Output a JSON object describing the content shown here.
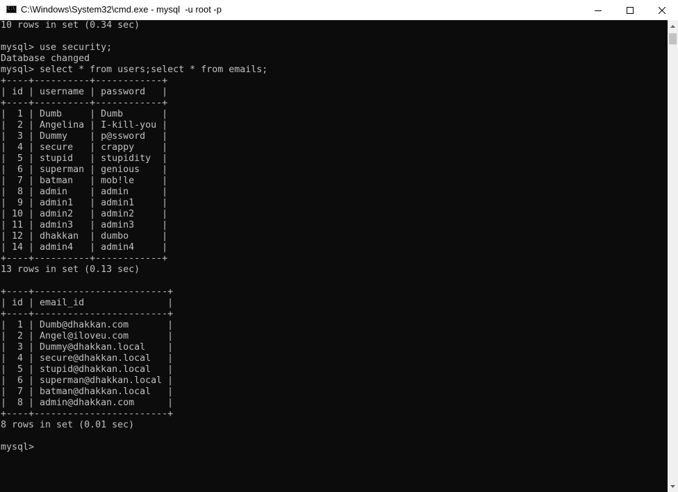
{
  "window": {
    "title": "C:\\Windows\\System32\\cmd.exe - mysql  -u root -p",
    "icon": "cmd-icon",
    "icon_text": "C:\\"
  },
  "console": {
    "lines": [
      "10 rows in set (0.34 sec)",
      "",
      "mysql> use security;",
      "Database changed",
      "mysql> select * from users;select * from emails;",
      "+----+----------+------------+",
      "| id | username | password   |",
      "+----+----------+------------+",
      "|  1 | Dumb     | Dumb       |",
      "|  2 | Angelina | I-kill-you |",
      "|  3 | Dummy    | p@ssword   |",
      "|  4 | secure   | crappy     |",
      "|  5 | stupid   | stupidity  |",
      "|  6 | superman | genious    |",
      "|  7 | batman   | mob!le     |",
      "|  8 | admin    | admin      |",
      "|  9 | admin1   | admin1     |",
      "| 10 | admin2   | admin2     |",
      "| 11 | admin3   | admin3     |",
      "| 12 | dhakkan  | dumbo      |",
      "| 14 | admin4   | admin4     |",
      "+----+----------+------------+",
      "13 rows in set (0.13 sec)",
      "",
      "+----+------------------------+",
      "| id | email_id               |",
      "+----+------------------------+",
      "|  1 | Dumb@dhakkan.com       |",
      "|  2 | Angel@iloveu.com       |",
      "|  3 | Dummy@dhakkan.local    |",
      "|  4 | secure@dhakkan.local   |",
      "|  5 | stupid@dhakkan.local   |",
      "|  6 | superman@dhakkan.local |",
      "|  7 | batman@dhakkan.local   |",
      "|  8 | admin@dhakkan.com      |",
      "+----+------------------------+",
      "8 rows in set (0.01 sec)",
      "",
      "mysql>"
    ]
  },
  "colors": {
    "background": "#0c0c0c",
    "text": "#c0c0c0",
    "titlebar": "#ffffff"
  }
}
